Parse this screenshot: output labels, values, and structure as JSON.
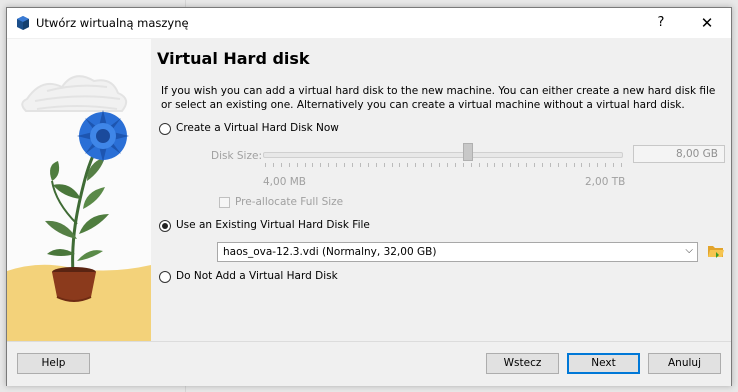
{
  "window": {
    "title": "Utwórz wirtualną maszynę",
    "help_glyph": "?",
    "close_glyph": "✕"
  },
  "page": {
    "heading": "Virtual Hard disk",
    "description": "If you wish you can add a virtual hard disk to the new machine. You can either create a new hard disk file or select an existing one. Alternatively you can create a virtual machine without a virtual hard disk."
  },
  "options": {
    "create_new": {
      "label": "Create a Virtual Hard Disk Now",
      "selected": false
    },
    "use_existing": {
      "label": "Use an Existing Virtual Hard Disk File",
      "selected": true
    },
    "no_disk": {
      "label": "Do Not Add a Virtual Hard Disk",
      "selected": false
    }
  },
  "disk_size": {
    "label": "Disk Size:",
    "value": "8,00 GB",
    "min_label": "4,00 MB",
    "max_label": "2,00 TB",
    "enabled": false
  },
  "preallocate": {
    "label": "Pre-allocate Full Size",
    "checked": false,
    "enabled": false
  },
  "existing_file": {
    "selected": "haos_ova-12.3.vdi (Normalny, 32,00 GB)",
    "arrow_glyph": "⌵"
  },
  "buttons": {
    "help": "Help",
    "back": "Wstecz",
    "next": "Next",
    "cancel": "Anuluj"
  },
  "icons": {
    "app": "virtualbox-icon",
    "folder": "folder-open-icon"
  },
  "colors": {
    "accent": "#0078d7",
    "flower_blue": "#2a6fd6",
    "pot": "#8b3a1c",
    "ground": "#f3d27a"
  }
}
